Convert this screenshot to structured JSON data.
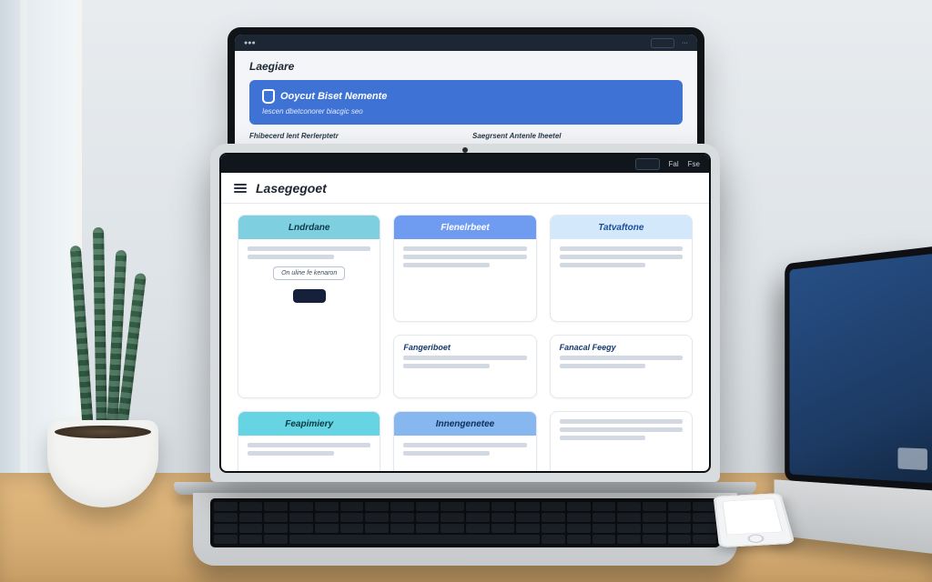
{
  "back_monitor": {
    "brand": "Laegiare",
    "menu_items": [
      "",
      "",
      ""
    ],
    "search_label": "",
    "hero_title": "Ooycut Biset Nemente",
    "hero_sub": "Iescen dbetconorer biacgic seo",
    "col1_heading": "Fhibecerd lent Rerlerptetr",
    "col2_heading": "Saegrsent Antenle Iheetel"
  },
  "laptop": {
    "topbar": {
      "left": "",
      "btn1": "",
      "btn2": "Fal",
      "btn3": "Fse"
    },
    "brand": "Lasegegoet",
    "cards": [
      {
        "title": "Lndrdane",
        "tint": "cyan",
        "outline_btn": "On uline fe kenaron",
        "solid_btn": ""
      },
      {
        "title": "Flenelrbeet",
        "tint": "blue",
        "outline_btn": "",
        "solid_btn": ""
      },
      {
        "title": "Tatvaftone",
        "tint": "light",
        "outline_btn": "",
        "solid_btn": ""
      },
      {
        "title": "",
        "tint": "",
        "sub_title": "Fangeriboet"
      },
      {
        "title": "",
        "tint": "",
        "sub_title": "Fanacal Feegy"
      },
      {
        "title": "Feapimiery",
        "tint": "cyan2",
        "outline_btn": "",
        "solid_btn": ""
      },
      {
        "title": "Innengenetee",
        "tint": "sky",
        "outline_btn": "",
        "solid_btn": ""
      }
    ]
  }
}
